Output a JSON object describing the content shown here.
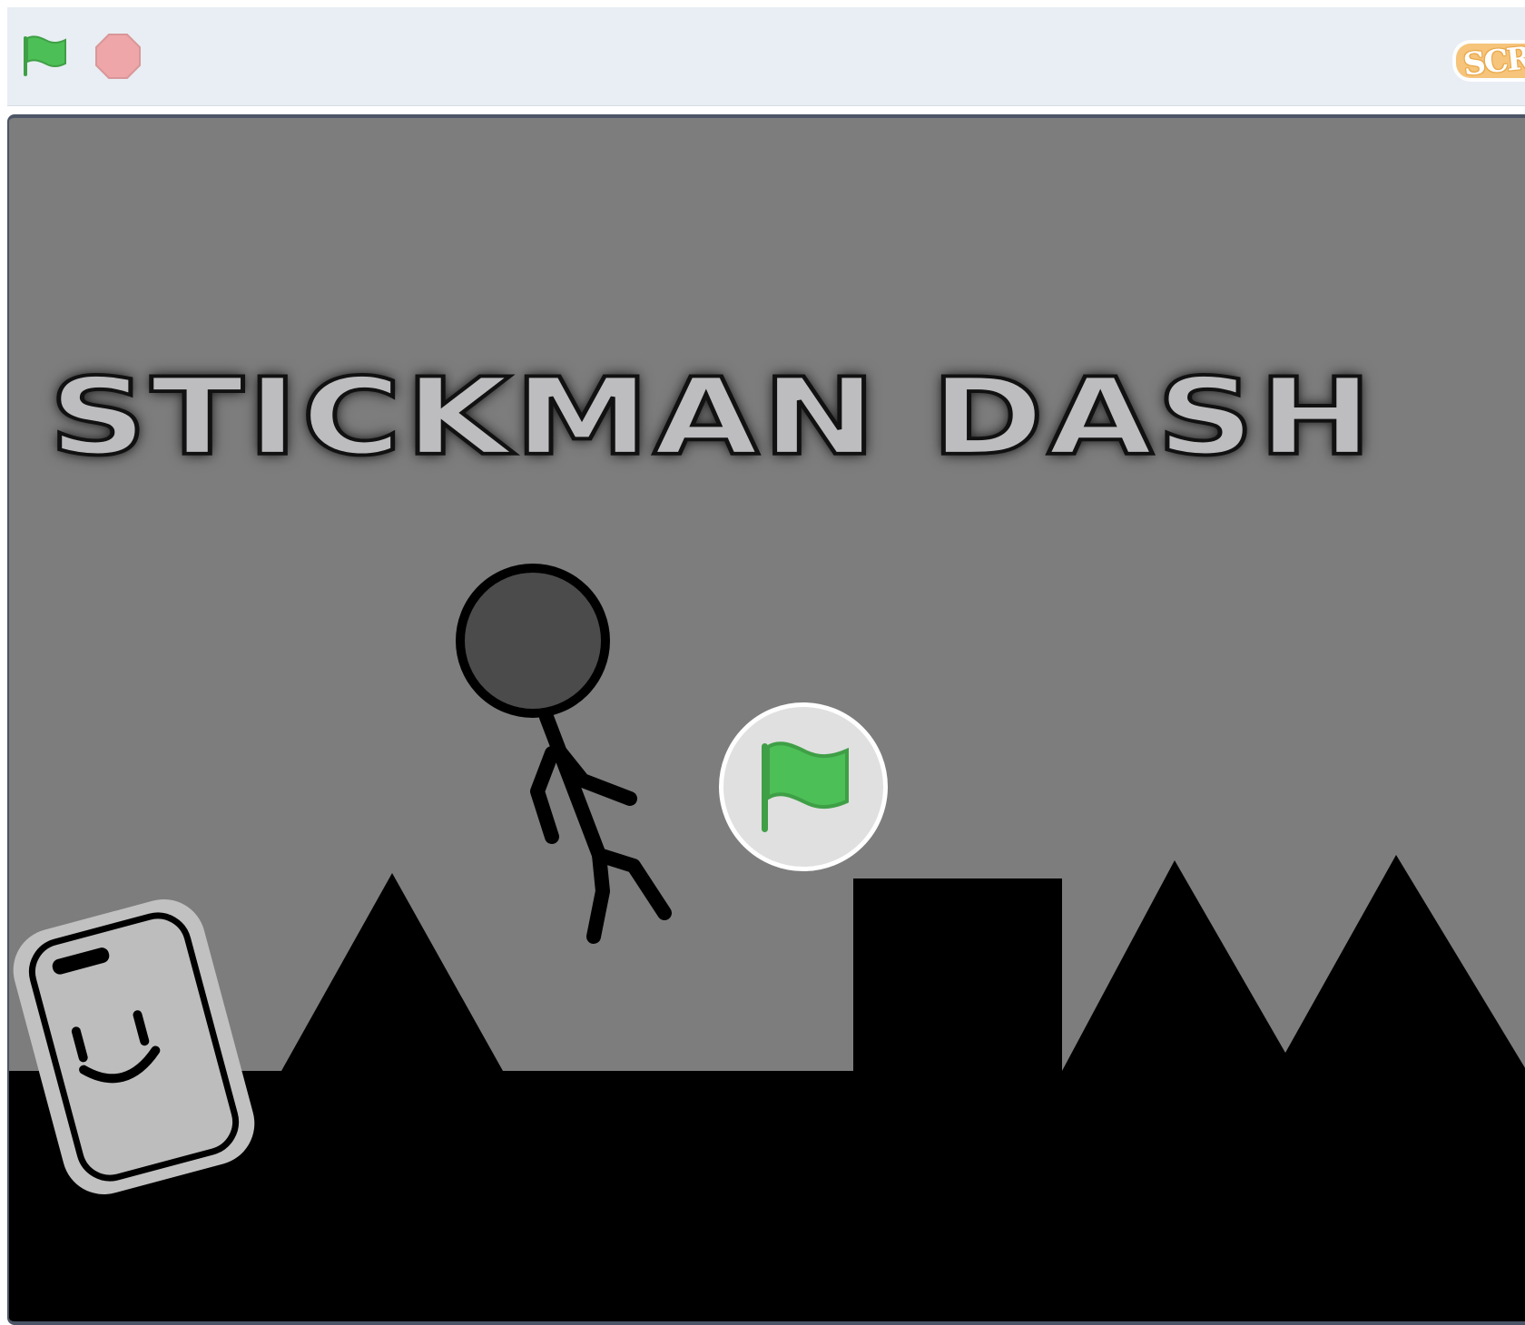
{
  "toolbar": {
    "green_flag_icon": "green-flag-icon",
    "stop_icon": "stop-sign-icon",
    "flag_color": "#4cbf56",
    "stop_color": "#eea6a8",
    "logo_text": "SCRATCH"
  },
  "stage": {
    "background_color": "#7d7d7d",
    "title": "STICKMAN DASH",
    "overlay_icon": "green-flag-icon",
    "ground_color": "#000000",
    "mobile_badge_icon": "smiling-phone-icon"
  }
}
